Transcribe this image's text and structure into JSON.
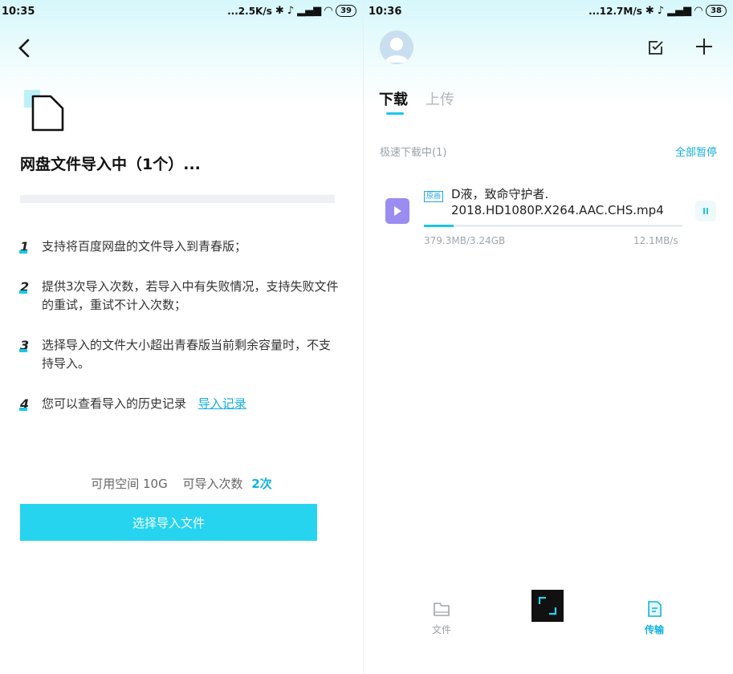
{
  "left": {
    "status": {
      "time": "10:35",
      "speed": "...2.5K/s",
      "battery": "39"
    },
    "title": "网盘文件导入中（1个）...",
    "rules": [
      {
        "num": "1",
        "text": "支持将百度网盘的文件导入到青春版；"
      },
      {
        "num": "2",
        "text": "提供3次导入次数，若导入中有失败情况，支持失败文件的重试，重试不计入次数；"
      },
      {
        "num": "3",
        "text": "选择导入的文件大小超出青春版当前剩余容量时，不支持导入。"
      },
      {
        "num": "4",
        "text": "您可以查看导入的历史记录",
        "link": "导入记录"
      }
    ],
    "quota": {
      "space_label": "可用空间 10G",
      "count_label": "可导入次数",
      "count_value": "2次"
    },
    "select_button": "选择导入文件"
  },
  "right": {
    "status": {
      "time": "10:36",
      "speed": "...12.7M/s",
      "battery": "38"
    },
    "tabs": [
      {
        "label": "下载",
        "active": true
      },
      {
        "label": "上传",
        "active": false
      }
    ],
    "section_label": "极速下载中(1)",
    "pause_all": "全部暂停",
    "task": {
      "badge": "原画",
      "name_line1": "D液，致命守护者.",
      "name_line2": "2018.HD1080P.X264.AAC.CHS.mp4",
      "progress": "379.3MB/3.24GB",
      "progress_fraction": 0.114,
      "rate": "12.1MB/s"
    },
    "nav": [
      {
        "label": "文件",
        "icon": "folder-icon"
      },
      {
        "label": "传输",
        "icon": "transfer-icon",
        "active": true
      }
    ]
  },
  "colors": {
    "accent": "#19c7e6",
    "link": "#12aee0",
    "video_icon": "#9b8cf2"
  }
}
